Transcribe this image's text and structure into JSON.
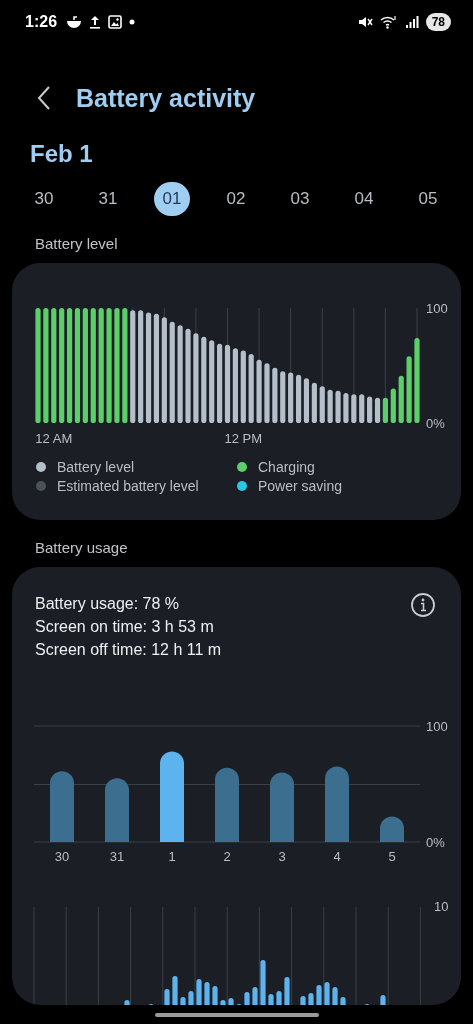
{
  "status_bar": {
    "time": "1:26",
    "battery": "78"
  },
  "header": {
    "title": "Battery activity"
  },
  "date_title": "Feb 1",
  "days": [
    {
      "label": "30",
      "selected": false
    },
    {
      "label": "31",
      "selected": false
    },
    {
      "label": "01",
      "selected": true
    },
    {
      "label": "02",
      "selected": false
    },
    {
      "label": "03",
      "selected": false
    },
    {
      "label": "04",
      "selected": false
    },
    {
      "label": "05",
      "selected": false
    }
  ],
  "battery_level": {
    "heading": "Battery level",
    "chart_data": {
      "type": "bar",
      "grid": true,
      "ylim": [
        0,
        100
      ],
      "yticks": [
        {
          "value": 0,
          "label": "0%"
        },
        {
          "value": 100,
          "label": "100"
        }
      ],
      "categories": [
        null,
        null,
        "12 AM",
        null,
        null,
        null,
        null,
        null,
        null,
        null,
        null,
        null,
        null,
        null,
        null,
        null,
        null,
        null,
        null,
        null,
        null,
        null,
        null,
        null,
        null,
        null,
        "12 PM",
        null,
        null,
        null,
        null,
        null,
        null,
        null,
        null,
        null,
        null,
        null,
        null,
        null,
        null,
        null,
        null,
        null,
        null,
        null,
        null,
        null,
        null
      ],
      "series": [
        {
          "name": "Battery level",
          "color": "#b4bfc9",
          "values": [
            null,
            null,
            null,
            null,
            null,
            null,
            null,
            null,
            null,
            null,
            null,
            null,
            98,
            98,
            96,
            95,
            92,
            88,
            85,
            82,
            78,
            75,
            72,
            69,
            68,
            65,
            63,
            60,
            55,
            52,
            48,
            45,
            44,
            42,
            39,
            35,
            32,
            29,
            28,
            26,
            25,
            25,
            23,
            22,
            null,
            null,
            null,
            null,
            null
          ]
        },
        {
          "name": "Charging",
          "color": "#5ccf6a",
          "values": [
            100,
            100,
            100,
            100,
            100,
            100,
            100,
            100,
            100,
            100,
            100,
            100,
            null,
            null,
            null,
            null,
            null,
            null,
            null,
            null,
            null,
            null,
            null,
            null,
            null,
            null,
            null,
            null,
            null,
            null,
            null,
            null,
            null,
            null,
            null,
            null,
            null,
            null,
            null,
            null,
            null,
            null,
            null,
            null,
            22,
            30,
            41,
            58,
            74
          ]
        },
        {
          "name": "Estimated battery level",
          "color": "#4a5258",
          "values": [
            null,
            null,
            null,
            null,
            null,
            null,
            null,
            null,
            null,
            null,
            null,
            null,
            null,
            null,
            null,
            null,
            null,
            null,
            null,
            null,
            null,
            null,
            null,
            null,
            null,
            null,
            null,
            null,
            null,
            null,
            null,
            null,
            null,
            null,
            null,
            null,
            null,
            null,
            null,
            null,
            null,
            null,
            null,
            null,
            null,
            null,
            null,
            null,
            null
          ]
        },
        {
          "name": "Power saving",
          "color": "#29c8e6",
          "values": [
            null,
            null,
            null,
            null,
            null,
            null,
            null,
            null,
            null,
            null,
            null,
            null,
            null,
            null,
            null,
            null,
            null,
            null,
            null,
            null,
            null,
            null,
            null,
            null,
            null,
            null,
            null,
            null,
            null,
            null,
            null,
            null,
            null,
            null,
            null,
            null,
            null,
            null,
            null,
            null,
            null,
            null,
            null,
            null,
            null,
            null,
            null,
            null,
            null
          ]
        }
      ]
    }
  },
  "battery_usage": {
    "heading": "Battery usage",
    "summary": [
      "Battery usage: 78 %",
      "Screen on time: 3 h 53 m",
      "Screen off time: 12 h 11 m"
    ],
    "chart_data": {
      "type": "bar",
      "grid": true,
      "categories": [
        "30",
        "31",
        "1",
        "2",
        "3",
        "4",
        "5"
      ],
      "ylim": [
        0,
        100
      ],
      "yticks": [
        {
          "value": 0,
          "label": "0%"
        },
        {
          "value": 100,
          "label": "100"
        }
      ],
      "series": [
        {
          "color": "#3b6e8f",
          "values": [
            61,
            55,
            null,
            64,
            60,
            65,
            22
          ]
        },
        {
          "color": "#5db3ee",
          "values": [
            null,
            null,
            78,
            null,
            null,
            null,
            null
          ]
        }
      ]
    },
    "hourly_axis_label": "10"
  }
}
